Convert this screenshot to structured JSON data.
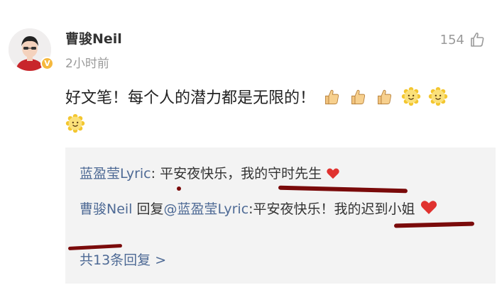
{
  "post": {
    "username": "曹骏Neil",
    "timestamp": "2小时前",
    "like_count": "154",
    "verified_badge": "V",
    "comment_text": "好文笔！每个人的潜力都是无限的！"
  },
  "replies": {
    "reply1": {
      "author": "蓝盈莹Lyric",
      "separator": ": ",
      "text": "平安夜快乐，我的守时先生"
    },
    "reply2": {
      "author": "曹骏Neil",
      "reply_word": " 回复",
      "mention": "@蓝盈莹Lyric",
      "separator": ":",
      "text": "平安夜快乐！我的迟到小姐"
    },
    "more_replies": "共13条回复 >"
  },
  "icons": [
    "thumbs-up-icon",
    "smile-emoji-icon",
    "heart-icon",
    "like-icon"
  ],
  "colors": {
    "link": "#4e6a95",
    "heart": "#e0322f",
    "annotation": "#7a0a0a"
  }
}
